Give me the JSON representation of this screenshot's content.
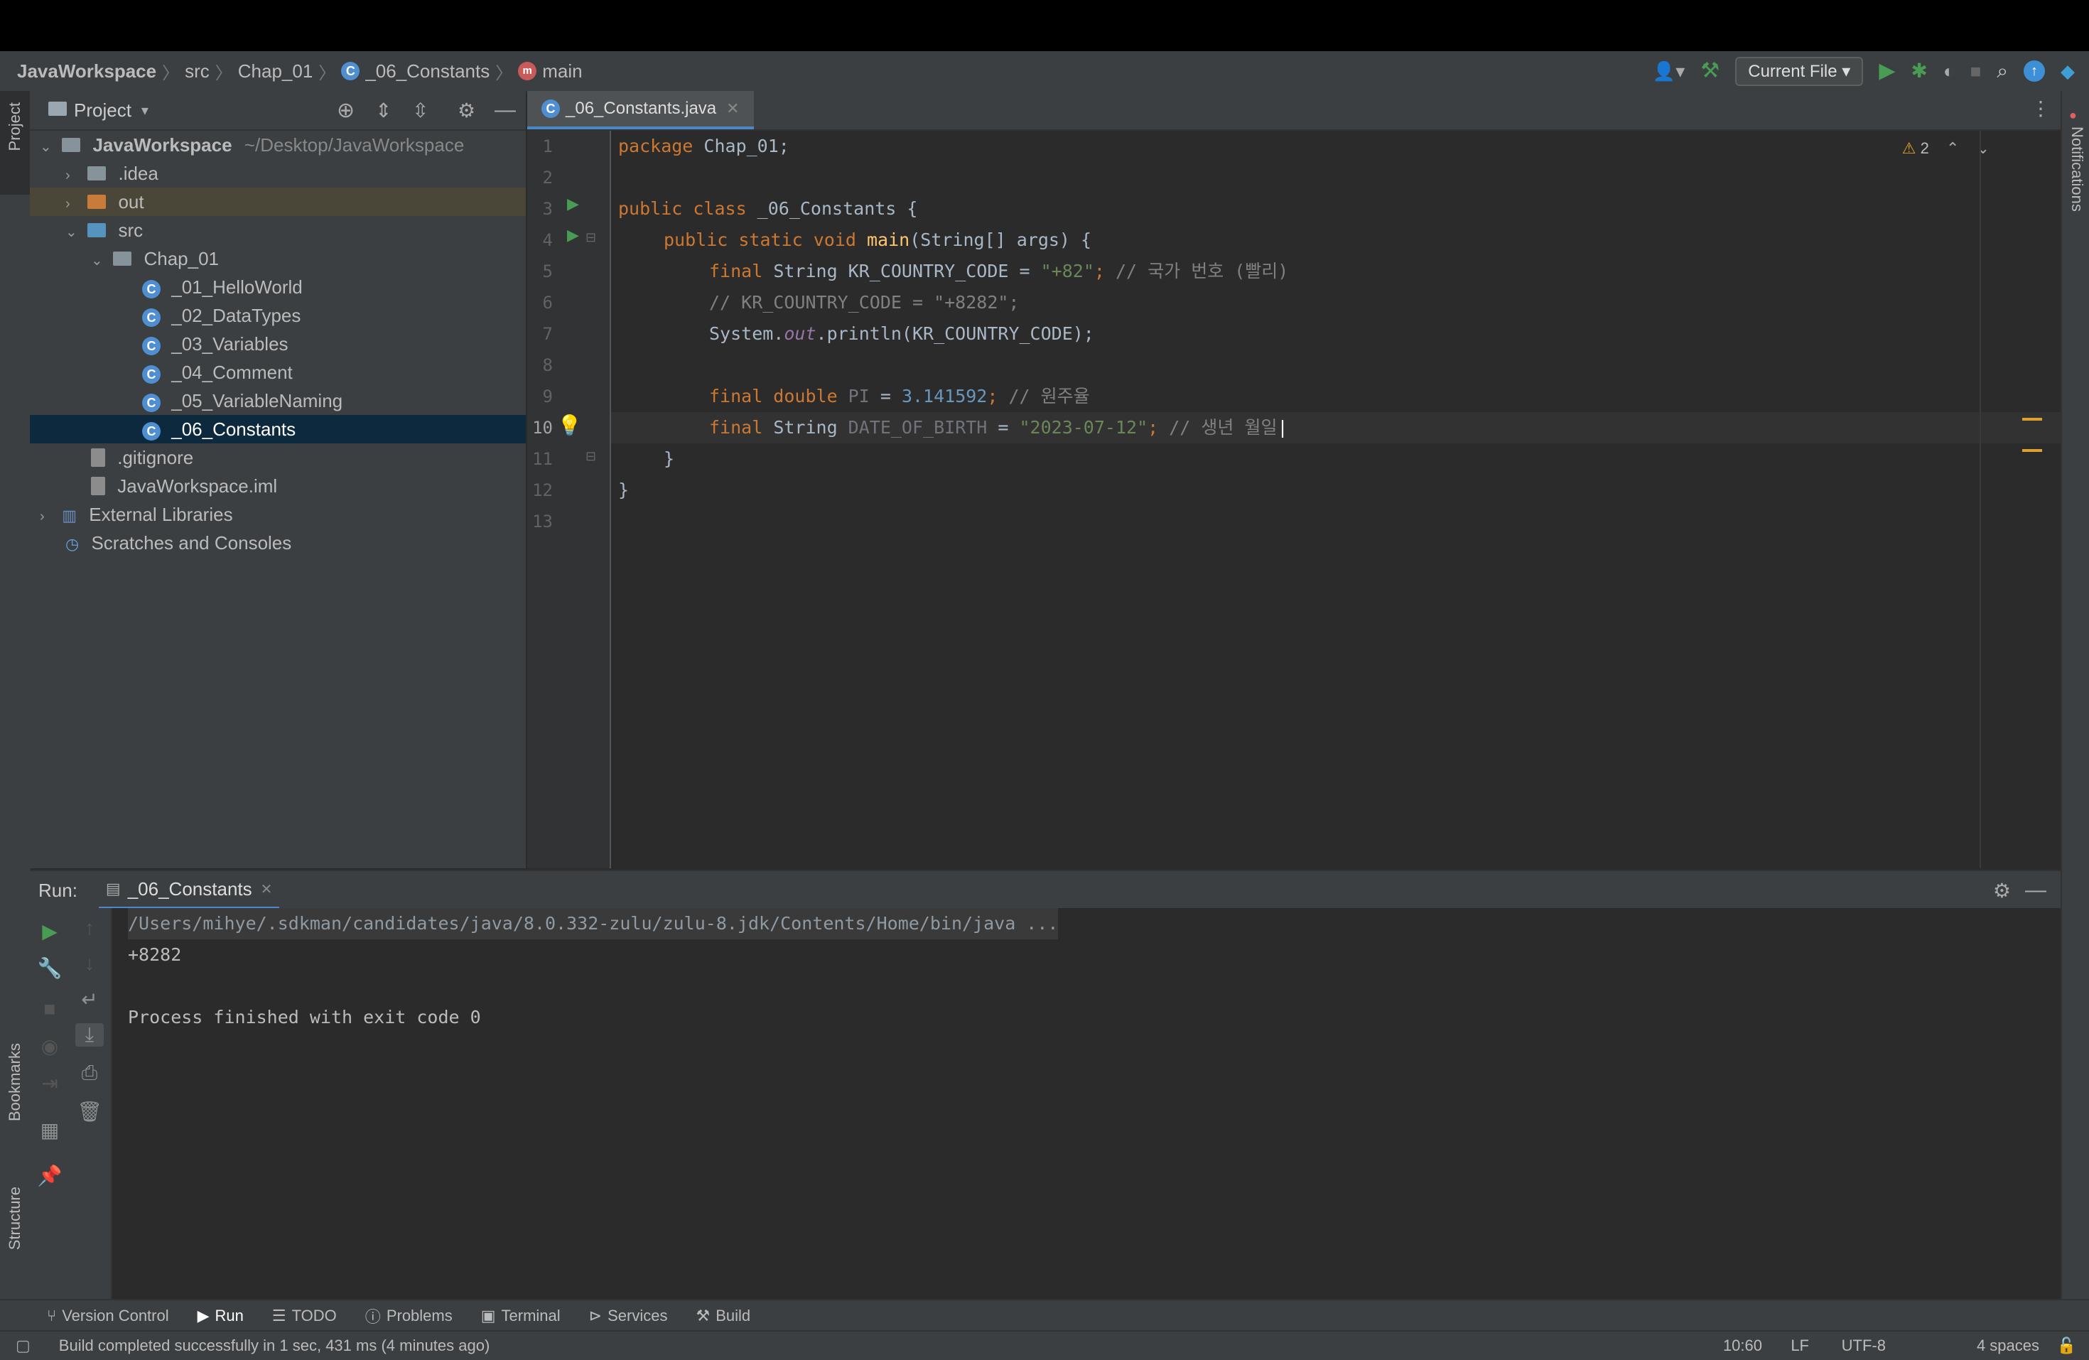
{
  "breadcrumbs": [
    "JavaWorkspace",
    "src",
    "Chap_01",
    "_06_Constants",
    "main"
  ],
  "toolbar": {
    "run_config": "Current File"
  },
  "left_strip": {
    "project": "Project",
    "bookmarks": "Bookmarks",
    "structure": "Structure"
  },
  "right_strip": {
    "notifications": "Notifications"
  },
  "project_panel": {
    "title": "Project",
    "tree": [
      {
        "label": "JavaWorkspace",
        "path": "~/Desktop/JavaWorkspace"
      },
      {
        "label": ".idea"
      },
      {
        "label": "out"
      },
      {
        "label": "src"
      },
      {
        "label": "Chap_01"
      },
      {
        "label": "_01_HelloWorld"
      },
      {
        "label": "_02_DataTypes"
      },
      {
        "label": "_03_Variables"
      },
      {
        "label": "_04_Comment"
      },
      {
        "label": "_05_VariableNaming"
      },
      {
        "label": "_06_Constants"
      },
      {
        "label": ".gitignore"
      },
      {
        "label": "JavaWorkspace.iml"
      },
      {
        "label": "External Libraries"
      },
      {
        "label": "Scratches and Consoles"
      }
    ]
  },
  "editor": {
    "tab": "_06_Constants.java",
    "warnings": "2",
    "line_numbers": [
      "1",
      "2",
      "3",
      "4",
      "5",
      "6",
      "7",
      "8",
      "9",
      "10",
      "11",
      "12",
      "13"
    ],
    "code": {
      "l1_kw": "package",
      "l1_rest": " Chap_01;",
      "l3_kw": "public class",
      "l3_rest": " _06_Constants {",
      "l4_kw": "public static void",
      "l4_fn": "main",
      "l4_rest": "(String[] args) {",
      "l5_kw": "final",
      "l5_a": " String KR_COUNTRY_CODE = ",
      "l5_str": "\"+82\"",
      "l5_semi": ";",
      "l5_cmt": " // 국가 번호 (빨리)",
      "l6_cmt": "// KR_COUNTRY_CODE = \"+8282\";",
      "l7_a": "System.",
      "l7_it": "out",
      "l7_b": ".println(KR_COUNTRY_CODE);",
      "l9_kw": "final double",
      "l9_var": " PI",
      "l9_eq": " = ",
      "l9_num": "3.141592",
      "l9_semi": ";",
      "l9_cmt": " // 원주율",
      "l10_kw": "final",
      "l10_a": " String",
      "l10_var": " DATE_OF_BIRTH",
      "l10_eq": " = ",
      "l10_str": "\"2023-07-12\"",
      "l10_semi": ";",
      "l10_cmt": " // 생년 월일",
      "l11": "}",
      "l12": "}"
    }
  },
  "run_panel": {
    "label": "Run:",
    "tab": "_06_Constants",
    "output": [
      "/Users/mihye/.sdkman/candidates/java/8.0.332-zulu/zulu-8.jdk/Contents/Home/bin/java ...",
      "+8282",
      "",
      "Process finished with exit code 0"
    ]
  },
  "bottom_tabs": [
    "Version Control",
    "Run",
    "TODO",
    "Problems",
    "Terminal",
    "Services",
    "Build"
  ],
  "status": {
    "message": "Build completed successfully in 1 sec, 431 ms (4 minutes ago)",
    "position": "10:60",
    "line_sep": "LF",
    "encoding": "UTF-8",
    "indent": "4 spaces"
  },
  "colors": {
    "accent": "#4a88c7",
    "keyword": "#cc7832",
    "string": "#6a8759",
    "number": "#6897bb",
    "comment": "#808080",
    "function": "#ffc66d",
    "run_green": "#499c54"
  }
}
